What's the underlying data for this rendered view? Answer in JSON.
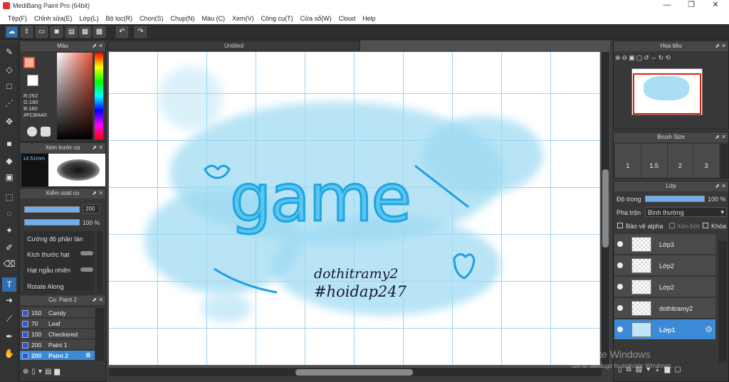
{
  "window": {
    "title": "MediBang Paint Pro (64bit)",
    "min": "—",
    "max": "❐",
    "close": "✕"
  },
  "menu": [
    "Tệp(F)",
    "Chỉnh sửa(E)",
    "Lớp(L)",
    "Bộ lọc(R)",
    "Chọn(S)",
    "Chụp(N)",
    "Màu (C)",
    "Xem(V)",
    "Công cụ(T)",
    "Cửa sổ(W)",
    "Cloud",
    "Help"
  ],
  "document": {
    "tab": "Untitled"
  },
  "color_panel": {
    "title": "Màu",
    "r": "R:252",
    "g": "G:180",
    "b": "B:160",
    "hex": "#FCB4A0",
    "fg_color": "#fcb4a0"
  },
  "brush_preview": {
    "title": "Xem trước cọ",
    "size": "14.51mm"
  },
  "brush_control": {
    "title": "Kiểm soát cọ",
    "size_value": "200",
    "opacity_value": "100 %",
    "items": [
      "Cường độ phân tán",
      "Kích thước hạt",
      "Hạt ngẫu nhiên",
      "Rotate Along"
    ]
  },
  "brush_list": {
    "title": "Cọ: Paint 2",
    "items": [
      {
        "size": "150",
        "name": "Candy"
      },
      {
        "size": "70",
        "name": "Leaf"
      },
      {
        "size": "100",
        "name": "Checkered"
      },
      {
        "size": "200",
        "name": "Paint 1"
      },
      {
        "size": "200",
        "name": "Paint 2"
      }
    ]
  },
  "navigator": {
    "title": "Hoa tiêu"
  },
  "brush_size": {
    "title": "Brush Size",
    "sizes": [
      "1",
      "1.5",
      "2",
      "3"
    ]
  },
  "layers_panel": {
    "title": "Lớp",
    "opacity_label": "Độ trong",
    "opacity_value": "100 %",
    "opacity": 1.0,
    "blend_label": "Pha trộn",
    "blend_value": "Bình thường",
    "protect_alpha": "Bảo vệ alpha",
    "clipping": "Xén bớt",
    "lock": "Khóa",
    "layers": [
      {
        "name": "Lớp3"
      },
      {
        "name": "Lớp2"
      },
      {
        "name": "Lớp2"
      },
      {
        "name": "dothitramy2"
      },
      {
        "name": "Lớp1"
      }
    ]
  },
  "artwork": {
    "main": "game",
    "line1": "dothitramy2",
    "line2": "#hoidap247"
  },
  "watermark": {
    "line1": "Activate Windows",
    "line2": "Go to Settings to activate Windows."
  }
}
